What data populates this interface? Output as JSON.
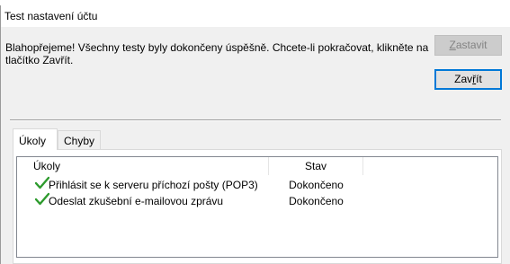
{
  "window": {
    "title": "Test nastavení účtu"
  },
  "message": "Blahopřejeme! Všechny testy byly dokončeny úspěšně. Chcete-li pokračovat, klikněte na tlačítko Zavřít.",
  "buttons": {
    "stop": {
      "label_pre": "",
      "label_ul": "Z",
      "label_post": "astavit",
      "enabled": false
    },
    "close": {
      "label_pre": "Zav",
      "label_ul": "ř",
      "label_post": "ít",
      "enabled": true
    }
  },
  "tabs": [
    {
      "label": "Úkoly",
      "active": true
    },
    {
      "label": "Chyby",
      "active": false
    }
  ],
  "tasks": {
    "columns": [
      "Úkoly",
      "Stav"
    ],
    "rows": [
      {
        "name": "Přihlásit se k serveru příchozí pošty (POP3)",
        "status": "Dokončeno",
        "icon": "check-icon"
      },
      {
        "name": "Odeslat zkušební e-mailovou zprávu",
        "status": "Dokončeno",
        "icon": "check-icon"
      }
    ]
  },
  "colors": {
    "check": "#2e9b2e",
    "default_button_border": "#0078d7"
  }
}
